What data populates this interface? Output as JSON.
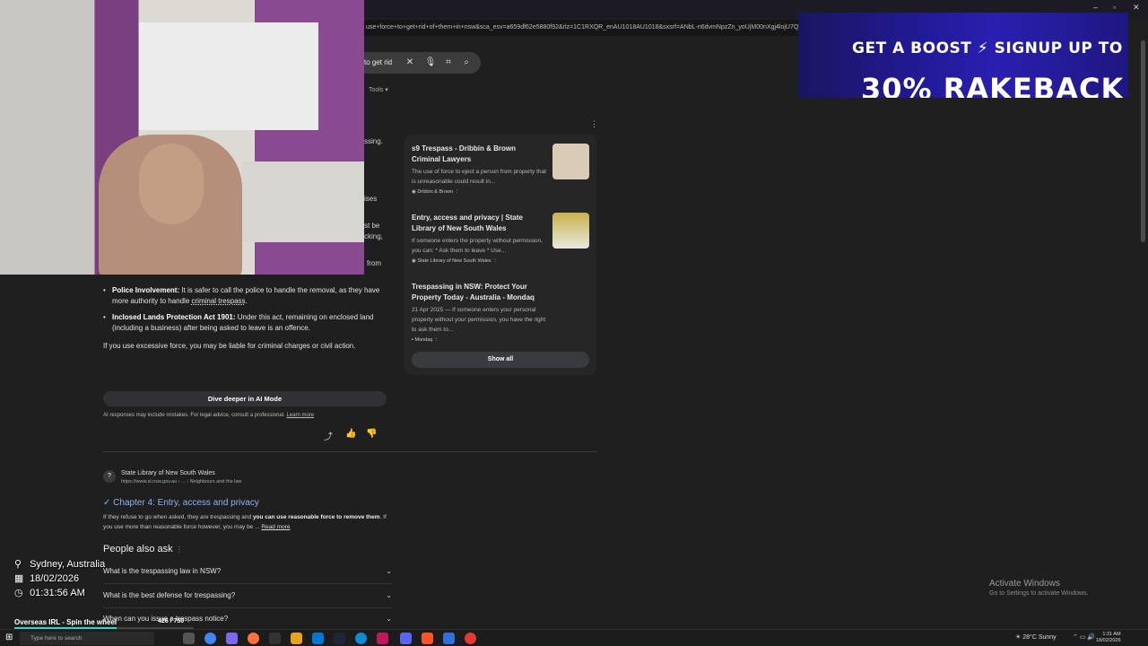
{
  "browser": {
    "url": "use+force+to+get+rid+of+them+in+nsw&sca_esv=a659df62e5880f92&rlz=1C1RXQR_enAU1018AU1018&sxsrf=ANbL-n6dvmNpzZn_yoUjM00nXgj4lojU7Q",
    "search_query_visible": "to get rid",
    "tools_label": "Tools"
  },
  "ad": {
    "line1": "GET A BOOST ⚡ SIGNUP UP TO",
    "line2": "30% RAKEBACK"
  },
  "ai_overview": {
    "cut_fragments": [
      "ssing.",
      "ises",
      "st be",
      "cking,",
      "from"
    ],
    "bullets": [
      {
        "bold": "Police Involvement:",
        "text": " It is safer to call the police to handle the removal, as they have more authority to handle ",
        "link": "criminal trespass",
        "tail": "."
      },
      {
        "bold": "Inclosed Lands Protection Act 1901:",
        "text": " Under this act, remaining on enclosed land (including a business) after being asked to leave is an offence.",
        "link": "",
        "tail": ""
      }
    ],
    "force_note": "If you use excessive force, you may be liable for criminal charges or civil action.",
    "dive_deeper": "Dive deeper in AI Mode",
    "disclaimer": "AI responses may include mistakes. For legal advice, consult a professional.",
    "learn_more": "Learn more"
  },
  "sources": [
    {
      "title": "s9 Trespass - Dribbin & Brown Criminal Lawyers",
      "desc": "The use of force to eject a person from property that is unreasonable could result in...",
      "site": "Dribbin & Brown",
      "thumb_color": "#d9cbb6"
    },
    {
      "title": "Entry, access and privacy | State Library of New South Wales",
      "desc": "If someone enters the property without permission, you can: * Ask them to leave * Use...",
      "site": "State Library of New South Wales",
      "thumb_color": "#c9b14a"
    },
    {
      "title": "Trespassing in NSW: Protect Your Property Today - Australia - Mondaq",
      "desc": "21 Apr 2025 — If someone enters your personal property without your permission, you have the right to ask them to...",
      "site": "Mondaq",
      "thumb_color": ""
    }
  ],
  "show_all": "Show all",
  "result": {
    "site": "State Library of New South Wales",
    "url": "https://www.sl.nsw.gov.au › ... › Neighbours and the law",
    "title": "Chapter 4: Entry, access and privacy",
    "snippet_pre": "If they refuse to go when asked, they are trespassing and ",
    "snippet_bold": "you can use reasonable force to remove them",
    "snippet_post": ". If you use more than reasonable force however, you may be ...",
    "read_more": "Read more"
  },
  "paa": {
    "title": "People also ask",
    "questions": [
      "What is the trespassing law in NSW?",
      "What is the best defense for trespassing?",
      "When can you issue a trespass notice?"
    ]
  },
  "overlay": {
    "location": "Sydney, Australia",
    "date": "18/02/2026",
    "time": "01:31:56 AM",
    "spin_label": "Overseas IRL - Spin the wheel",
    "spin_count": "426 / 750",
    "spin_progress": 0.568
  },
  "windows": {
    "activate_title": "Activate Windows",
    "activate_sub": "Go to Settings to activate Windows.",
    "search_placeholder": "Type here to search",
    "weather": "28°C  Sunny",
    "clock_time": "1:31 AM",
    "clock_date": "18/02/2026"
  },
  "colors": {
    "link": "#8ab4f8",
    "background": "#1f1f1f",
    "ad_bg": "#2a1fb0",
    "spin_bar": "#3fd0c9"
  }
}
